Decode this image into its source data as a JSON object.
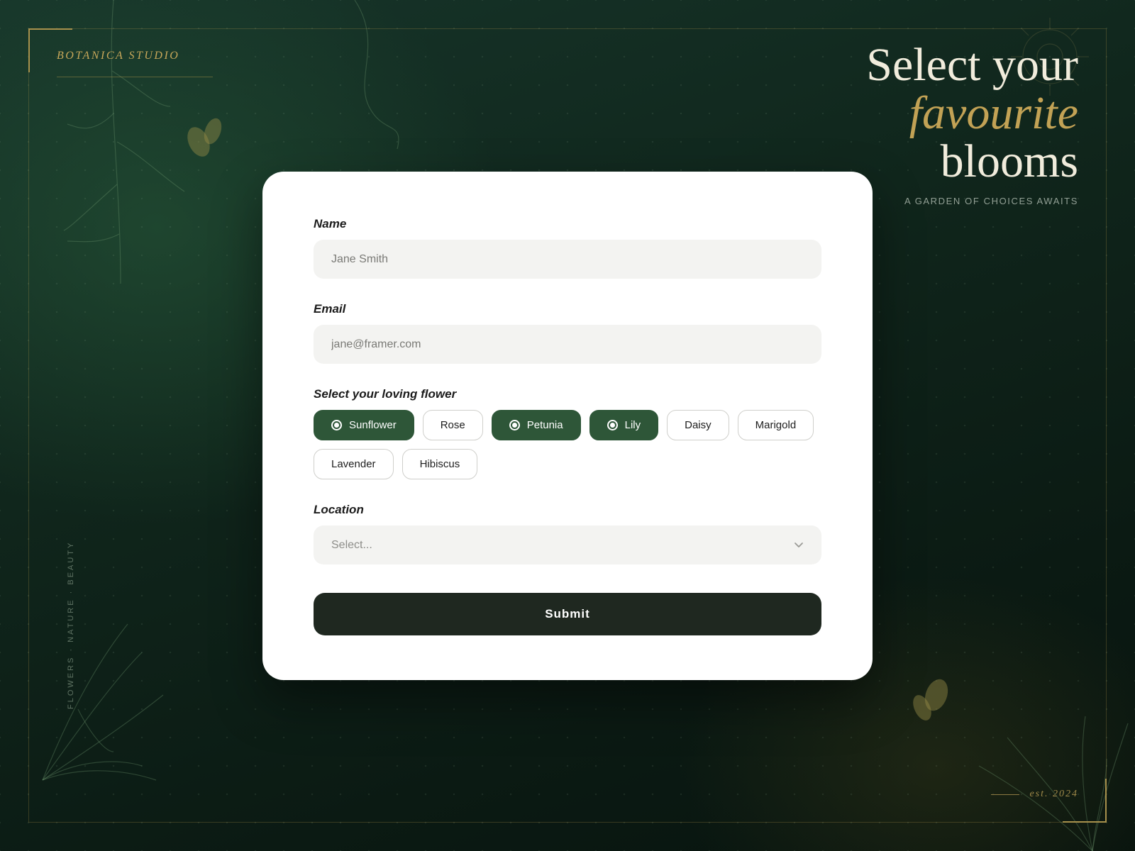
{
  "brand": {
    "name": "BOTANICA STUDIO"
  },
  "side_text": "FLOWERS · NATURE · BEAUTY",
  "hero": {
    "line1": "Select your",
    "line2": "favourite",
    "line3": "blooms",
    "subtitle": "A GARDEN OF CHOICES AWAITS"
  },
  "footer": {
    "est": "est. 2024"
  },
  "form": {
    "name": {
      "label": "Name",
      "placeholder": "Jane Smith"
    },
    "email": {
      "label": "Email",
      "placeholder": "jane@framer.com"
    },
    "flower": {
      "label": "Select your loving flower",
      "options": [
        {
          "label": "Sunflower",
          "selected": true
        },
        {
          "label": "Rose",
          "selected": false
        },
        {
          "label": "Petunia",
          "selected": true
        },
        {
          "label": "Lily",
          "selected": true
        },
        {
          "label": "Daisy",
          "selected": false
        },
        {
          "label": "Marigold",
          "selected": false
        },
        {
          "label": "Lavender",
          "selected": false
        },
        {
          "label": "Hibiscus",
          "selected": false
        }
      ]
    },
    "location": {
      "label": "Location",
      "placeholder": "Select..."
    },
    "submit_label": "Submit"
  },
  "colors": {
    "background": "#10261c",
    "accent_gold": "#c2a255",
    "chip_selected": "#2e5638",
    "submit": "#1f2820",
    "card": "#ffffff"
  },
  "icons": {
    "location_select": "chevron-down-icon",
    "selected_chip": "radio-dot-icon"
  }
}
